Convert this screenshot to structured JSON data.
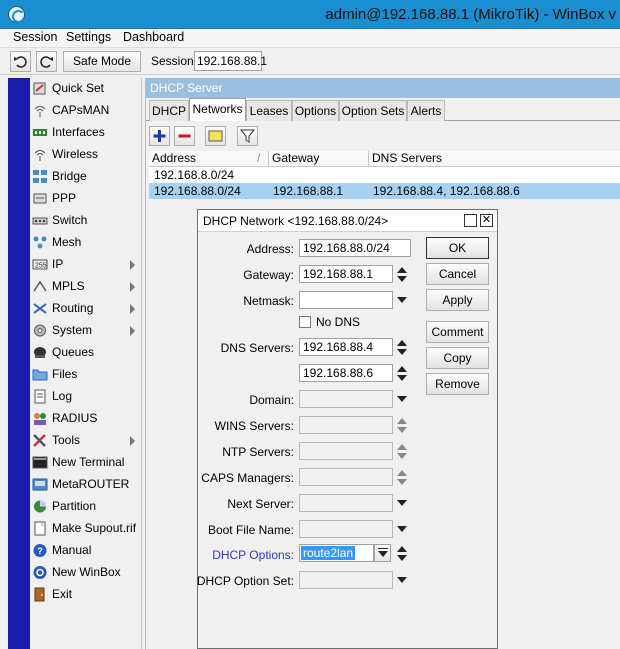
{
  "window": {
    "title": "admin@192.168.88.1 (MikroTik) - WinBox v"
  },
  "menu": [
    "Session",
    "Settings",
    "Dashboard"
  ],
  "toolbar": {
    "safe_mode_label": "Safe Mode",
    "session_label": "Session:",
    "session_value": "192.168.88.1"
  },
  "sidebar": {
    "items": [
      {
        "label": "Quick Set",
        "icon": "quick-set-icon",
        "submenu": false
      },
      {
        "label": "CAPsMAN",
        "icon": "capsman-icon",
        "submenu": false
      },
      {
        "label": "Interfaces",
        "icon": "interfaces-icon",
        "submenu": false
      },
      {
        "label": "Wireless",
        "icon": "wireless-icon",
        "submenu": false
      },
      {
        "label": "Bridge",
        "icon": "bridge-icon",
        "submenu": false
      },
      {
        "label": "PPP",
        "icon": "ppp-icon",
        "submenu": false
      },
      {
        "label": "Switch",
        "icon": "switch-icon",
        "submenu": false
      },
      {
        "label": "Mesh",
        "icon": "mesh-icon",
        "submenu": false
      },
      {
        "label": "IP",
        "icon": "ip-icon",
        "submenu": true
      },
      {
        "label": "MPLS",
        "icon": "mpls-icon",
        "submenu": true
      },
      {
        "label": "Routing",
        "icon": "routing-icon",
        "submenu": true
      },
      {
        "label": "System",
        "icon": "system-icon",
        "submenu": true
      },
      {
        "label": "Queues",
        "icon": "queues-icon",
        "submenu": false
      },
      {
        "label": "Files",
        "icon": "files-icon",
        "submenu": false
      },
      {
        "label": "Log",
        "icon": "log-icon",
        "submenu": false
      },
      {
        "label": "RADIUS",
        "icon": "radius-icon",
        "submenu": false
      },
      {
        "label": "Tools",
        "icon": "tools-icon",
        "submenu": true
      },
      {
        "label": "New Terminal",
        "icon": "terminal-icon",
        "submenu": false
      },
      {
        "label": "MetaROUTER",
        "icon": "metarouter-icon",
        "submenu": false
      },
      {
        "label": "Partition",
        "icon": "partition-icon",
        "submenu": false
      },
      {
        "label": "Make Supout.rif",
        "icon": "supout-icon",
        "submenu": false
      },
      {
        "label": "Manual",
        "icon": "manual-icon",
        "submenu": false
      },
      {
        "label": "New WinBox",
        "icon": "new-winbox-icon",
        "submenu": false
      },
      {
        "label": "Exit",
        "icon": "exit-icon",
        "submenu": false
      }
    ]
  },
  "dhcp_server": {
    "title": "DHCP Server",
    "tabs": [
      "DHCP",
      "Networks",
      "Leases",
      "Options",
      "Option Sets",
      "Alerts"
    ],
    "active_tab": "Networks",
    "columns": [
      "Address",
      "Gateway",
      "DNS Servers"
    ],
    "rows": [
      {
        "address": "192.168.8.0/24",
        "gateway": "",
        "dns": ""
      },
      {
        "address": "192.168.88.0/24",
        "gateway": "192.168.88.1",
        "dns": "192.168.88.4, 192.168.88.6"
      }
    ]
  },
  "dialog": {
    "title": "DHCP Network <192.168.88.0/24>",
    "fields": {
      "address_label": "Address:",
      "address_value": "192.168.88.0/24",
      "gateway_label": "Gateway:",
      "gateway_value": "192.168.88.1",
      "netmask_label": "Netmask:",
      "netmask_value": "",
      "no_dns_label": "No DNS",
      "dns_label": "DNS Servers:",
      "dns_value_1": "192.168.88.4",
      "dns_value_2": "192.168.88.6",
      "domain_label": "Domain:",
      "wins_label": "WINS Servers:",
      "ntp_label": "NTP Servers:",
      "caps_label": "CAPS Managers:",
      "next_server_label": "Next Server:",
      "boot_file_label": "Boot File Name:",
      "dhcp_options_label": "DHCP Options:",
      "dhcp_options_value": "route2lan",
      "dhcp_option_set_label": "DHCP Option Set:"
    },
    "buttons": {
      "ok": "OK",
      "cancel": "Cancel",
      "apply": "Apply",
      "comment": "Comment",
      "copy": "Copy",
      "remove": "Remove"
    }
  },
  "colors": {
    "titlebar": "#1a8ed0",
    "sidebar_strip": "#1a1ea8",
    "selection": "#a6d1f3",
    "highlight": "#3399ff"
  }
}
